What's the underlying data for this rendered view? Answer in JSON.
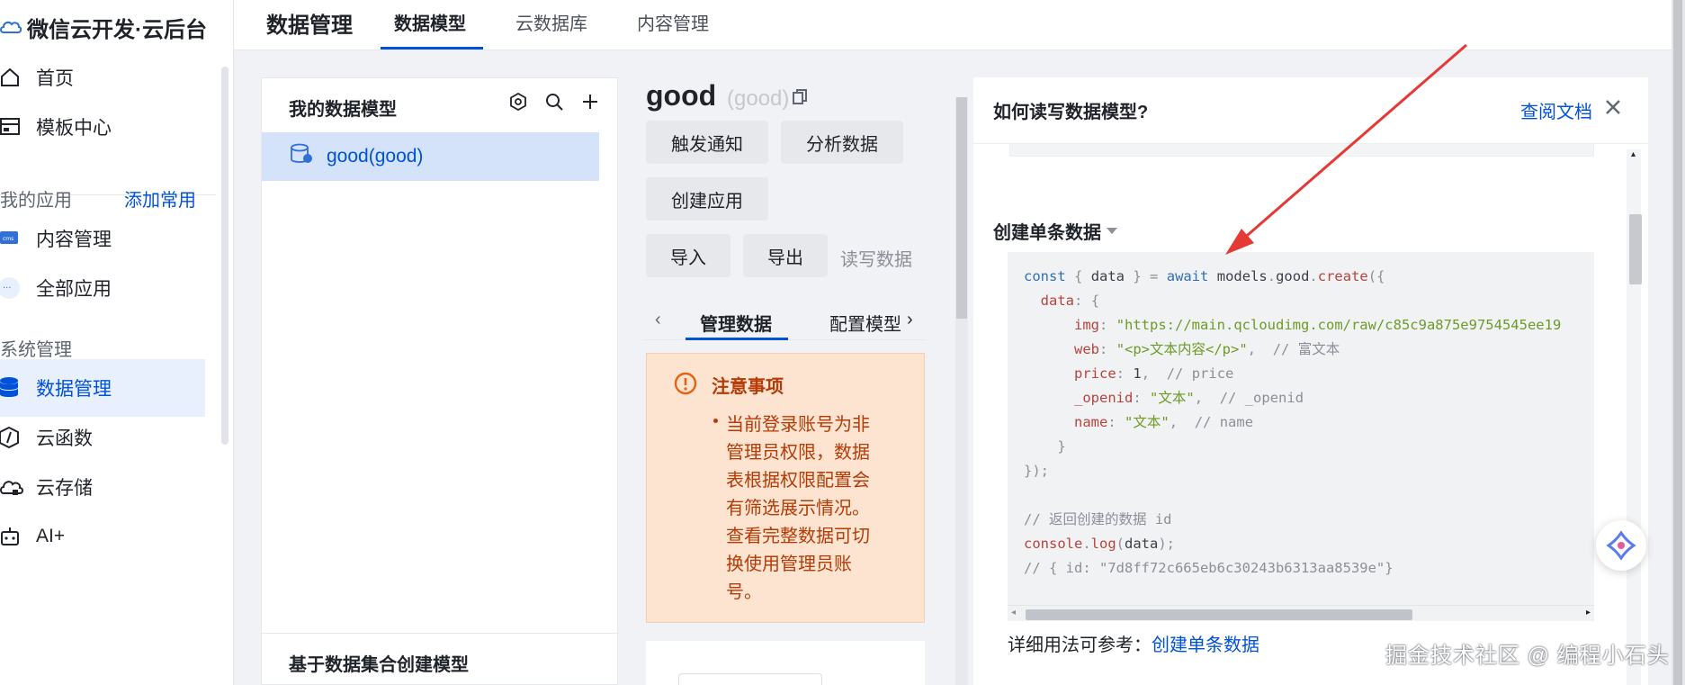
{
  "brand": {
    "title": "微信云开发·云后台"
  },
  "sidebar": {
    "items": [
      {
        "label": "首页",
        "icon": "home-icon"
      },
      {
        "label": "模板中心",
        "icon": "template-icon"
      },
      {
        "label": "内容管理",
        "icon": "cms-icon"
      },
      {
        "label": "全部应用",
        "icon": "more-icon"
      },
      {
        "label": "数据管理",
        "icon": "database-icon",
        "active": true
      },
      {
        "label": "云函数",
        "icon": "function-icon"
      },
      {
        "label": "云存储",
        "icon": "cloud-storage-icon"
      },
      {
        "label": "AI+",
        "icon": "robot-icon"
      }
    ],
    "my_apps_label": "我的应用",
    "add_common_label": "添加常用",
    "system_label": "系统管理"
  },
  "topnav": {
    "title": "数据管理",
    "tabs": [
      {
        "label": "数据模型",
        "active": true
      },
      {
        "label": "云数据库"
      },
      {
        "label": "内容管理"
      }
    ]
  },
  "models_panel": {
    "title": "我的数据模型",
    "items": [
      {
        "label": "good(good)",
        "selected": true
      }
    ],
    "footer": "基于数据集合创建模型"
  },
  "detail": {
    "name": "good",
    "sub": "(good)",
    "buttons": {
      "trigger": "触发通知",
      "analyze": "分析数据",
      "create_app": "创建应用",
      "import": "导入",
      "export": "导出"
    },
    "rw_label": "读写数据",
    "sub_tabs": {
      "manage": "管理数据",
      "config": "配置模型"
    },
    "notice": {
      "title": "注意事项",
      "body": "当前登录账号为非管理员权限，数据表根据权限配置会有筛选展示情况。 查看完整数据可切换使用管理员账号。"
    }
  },
  "docs": {
    "title": "如何读写数据模型?",
    "link": "查阅文档",
    "section": "创建单条数据",
    "code": {
      "img_url": "\"https://main.qcloudimg.com/raw/c85c9a875e9754545ee19",
      "web_val": "\"<p>文本内容</p>\"",
      "web_cmt": "// 富文本",
      "price_cmt": "// price",
      "openid_val": "\"文本\"",
      "openid_cmt": "// _openid",
      "name_val": "\"文本\"",
      "name_cmt": "// name",
      "return_cmt": "// 返回创建的数据 id",
      "result_cmt": "// { id: \"7d8ff72c665eb6c30243b6313aa8539e\"}"
    },
    "ref_prefix": "详细用法可参考：",
    "ref_link": "创建单条数据"
  },
  "watermark": "掘金技术社区 @ 编程小石头",
  "colors": {
    "accent": "#0052d9",
    "arrow": "#e53935",
    "notice_bg": "#fde4d0",
    "notice_text": "#b43c08"
  }
}
